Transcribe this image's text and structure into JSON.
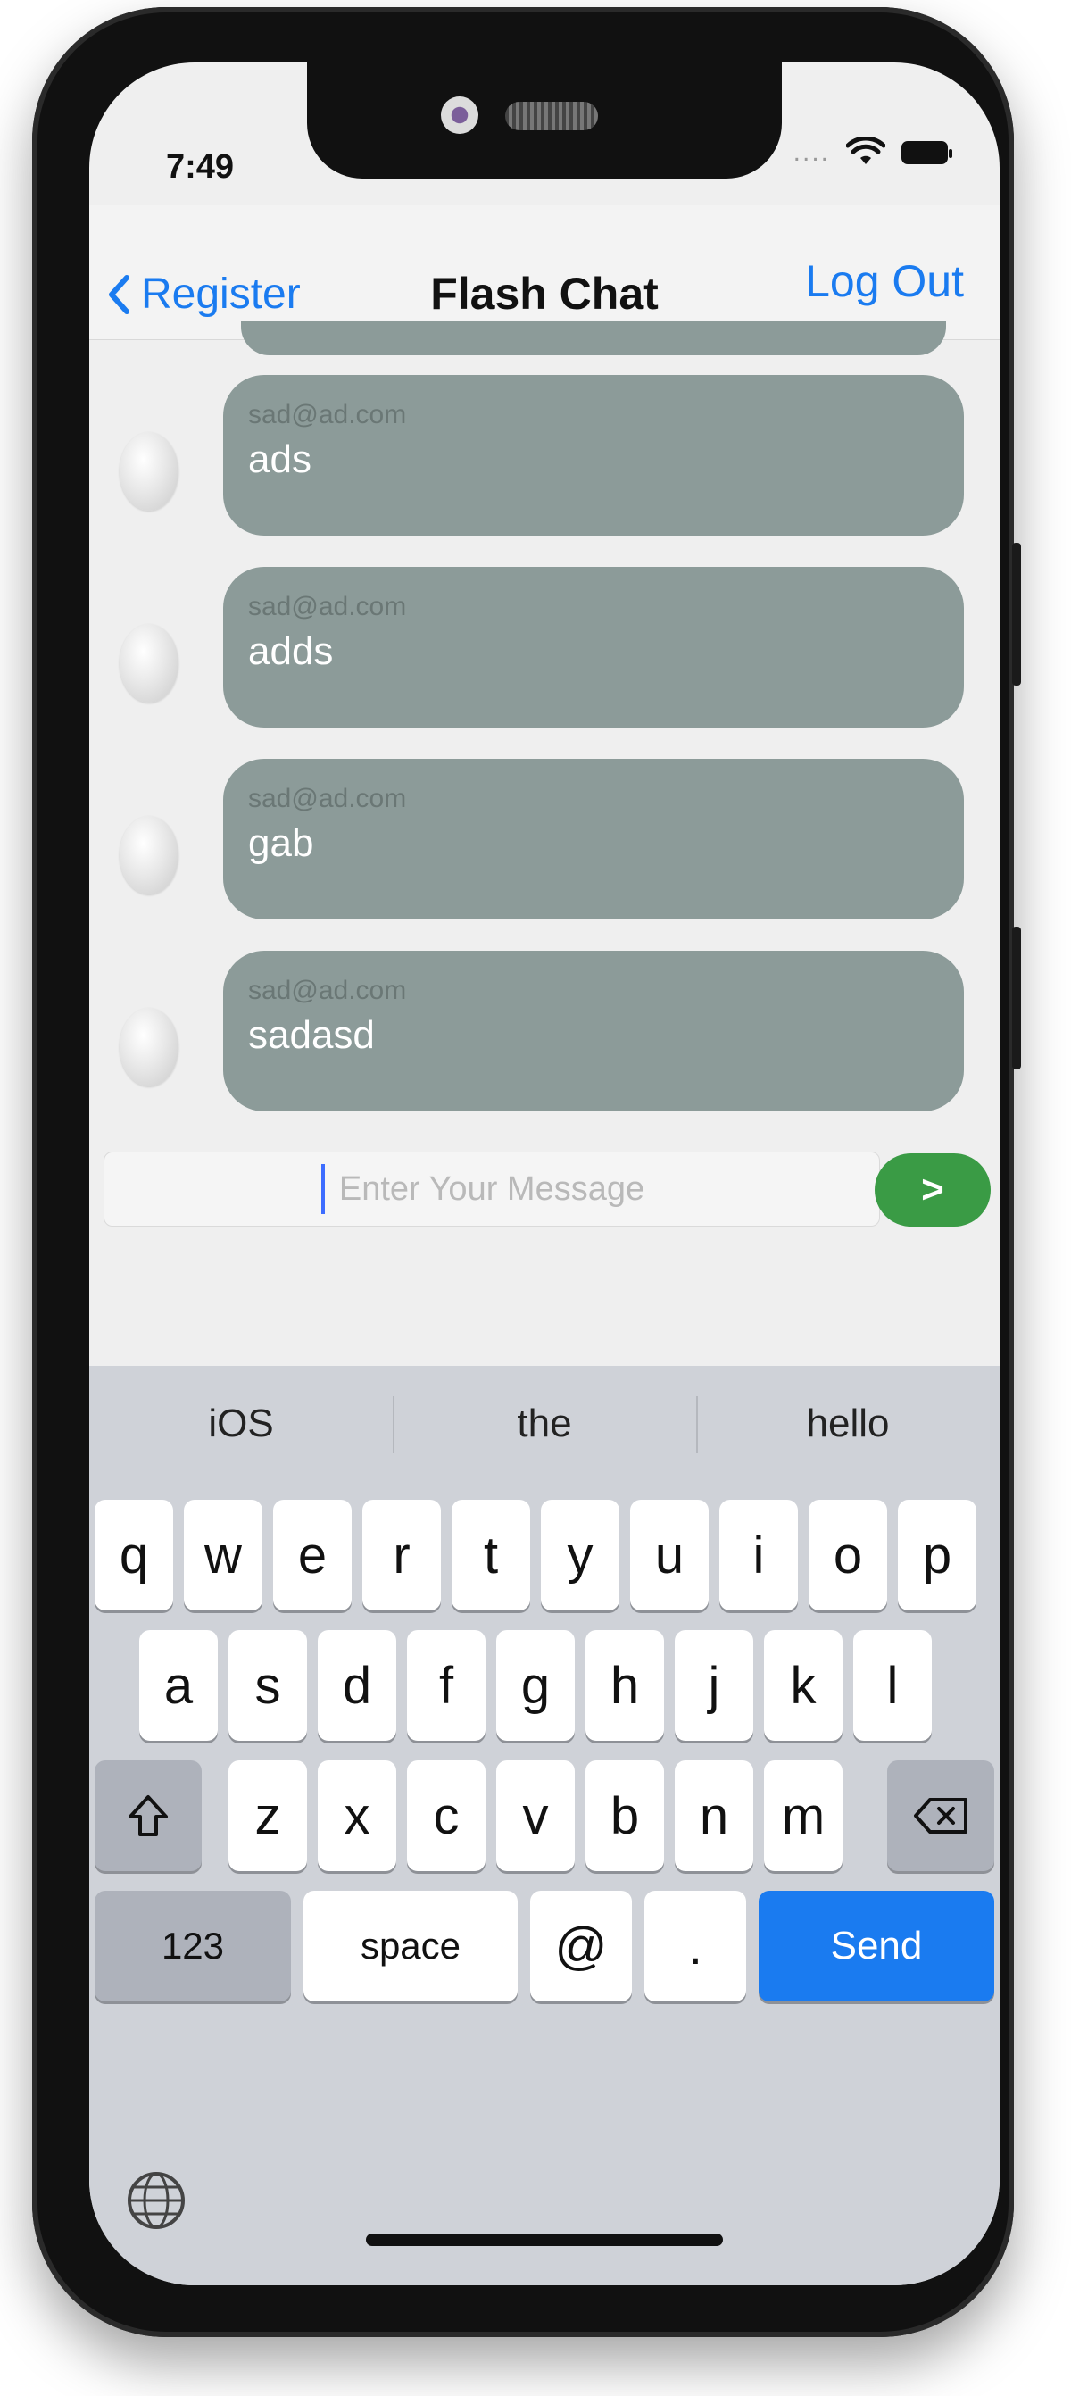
{
  "status": {
    "time": "7:49",
    "dots": "...."
  },
  "nav": {
    "back_label": "Register",
    "title": "Flash Chat",
    "logout_label": "Log Out"
  },
  "messages": [
    {
      "sender": "sad@ad.com",
      "text": "ads"
    },
    {
      "sender": "sad@ad.com",
      "text": "adds"
    },
    {
      "sender": "sad@ad.com",
      "text": "gab"
    },
    {
      "sender": "sad@ad.com",
      "text": "sadasd"
    }
  ],
  "composer": {
    "placeholder": "Enter Your Message",
    "send_label": ">"
  },
  "keyboard": {
    "suggestions": [
      "iOS",
      "the",
      "hello"
    ],
    "row1": [
      "q",
      "w",
      "e",
      "r",
      "t",
      "y",
      "u",
      "i",
      "o",
      "p"
    ],
    "row2": [
      "a",
      "s",
      "d",
      "f",
      "g",
      "h",
      "j",
      "k",
      "l"
    ],
    "row3": [
      "z",
      "x",
      "c",
      "v",
      "b",
      "n",
      "m"
    ],
    "numbers_label": "123",
    "space_label": "space",
    "at_label": "@",
    "dot_label": ".",
    "send_label": "Send"
  },
  "colors": {
    "accent": "#1a7bf0",
    "bubble": "#8c9b99",
    "send_button": "#3a9b45"
  }
}
